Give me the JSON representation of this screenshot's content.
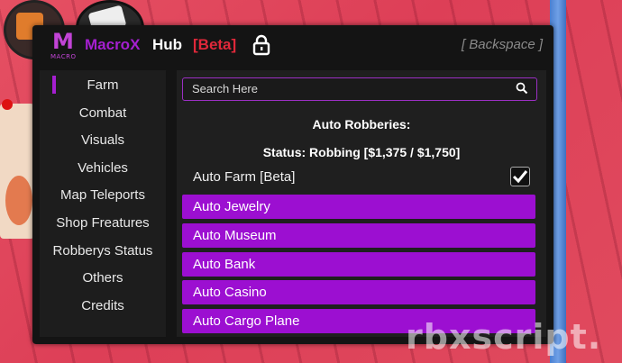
{
  "window": {
    "logo_letter": "M",
    "logo_sub": "MACRO",
    "title_part1": "MacroX",
    "title_part2": "Hub",
    "title_part3": "[Beta]",
    "hotkey": "[ Backspace ]"
  },
  "sidebar": {
    "items": [
      {
        "label": "Farm",
        "active": true
      },
      {
        "label": "Combat"
      },
      {
        "label": "Visuals"
      },
      {
        "label": "Vehicles"
      },
      {
        "label": "Map Teleports"
      },
      {
        "label": "Shop Freatures"
      },
      {
        "label": "Robberys Status"
      },
      {
        "label": "Others"
      },
      {
        "label": "Credits"
      }
    ]
  },
  "main": {
    "search_placeholder": "Search Here",
    "section_title": "Auto Robberies:",
    "status": "Status: Robbing [$1,375 / $1,750]",
    "toggle": {
      "label": "Auto Farm [Beta]",
      "checked": true
    },
    "buttons": [
      {
        "label": "Auto Jewelry"
      },
      {
        "label": "Auto Museum"
      },
      {
        "label": "Auto Bank"
      },
      {
        "label": "Auto Casino"
      },
      {
        "label": "Auto Cargo Plane"
      }
    ]
  },
  "watermark": "rbxscript.",
  "colors": {
    "accent": "#9c0fd1",
    "title_red": "#e0283a",
    "panel": "#141414"
  }
}
